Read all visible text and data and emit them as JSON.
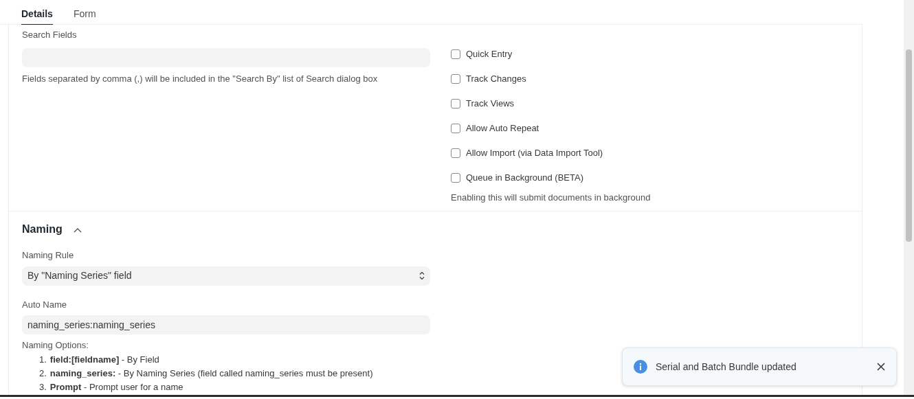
{
  "tabs": [
    {
      "label": "Details",
      "selected": true
    },
    {
      "label": "Form",
      "selected": false
    }
  ],
  "search_fields": {
    "label": "Search Fields",
    "help": "Fields separated by comma (,) will be included in the \"Search By\" list of Search dialog box"
  },
  "options": [
    {
      "label": "Quick Entry",
      "checked": false
    },
    {
      "label": "Track Changes",
      "checked": false
    },
    {
      "label": "Track Views",
      "checked": false
    },
    {
      "label": "Allow Auto Repeat",
      "checked": false
    },
    {
      "label": "Allow Import (via Data Import Tool)",
      "checked": false
    },
    {
      "label": "Queue in Background (BETA)",
      "checked": false
    }
  ],
  "options_help": "Enabling this will submit documents in background",
  "naming": {
    "title": "Naming",
    "expanded": true,
    "naming_rule": {
      "label": "Naming Rule",
      "value": "By \"Naming Series\" field"
    },
    "auto_name": {
      "label": "Auto Name",
      "value": "naming_series:naming_series"
    },
    "options_title": "Naming Options:",
    "options_list": [
      {
        "number": "1.",
        "text": "**field:[fieldname]** - By Field"
      },
      {
        "number": "2.",
        "text": "**naming_series:** - By Naming Series (field called naming_series must be present)"
      },
      {
        "number": "3.",
        "text": "**Prompt** - Prompt user for a name"
      }
    ]
  },
  "toast": {
    "message": "Serial and Batch Bundle updated"
  }
}
